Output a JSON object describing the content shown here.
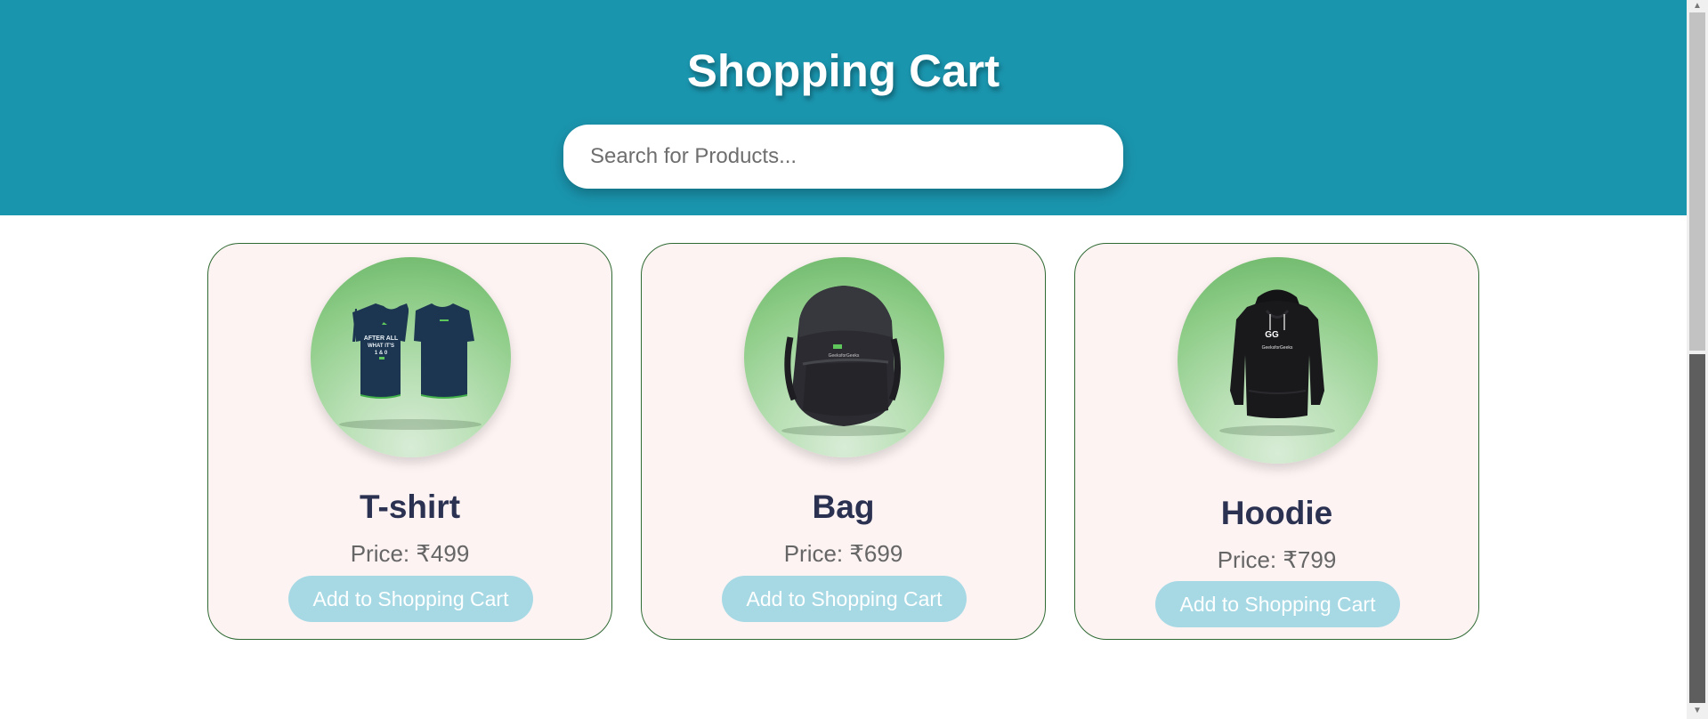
{
  "header": {
    "title": "Shopping Cart",
    "background_color": "#1a95ae"
  },
  "search": {
    "placeholder": "Search for Products...",
    "value": ""
  },
  "products": [
    {
      "name": "T-shirt",
      "price": "Price: ₹499",
      "button_label": "Add to Shopping Cart",
      "icon": "tshirt-icon"
    },
    {
      "name": "Bag",
      "price": "Price: ₹699",
      "button_label": "Add to Shopping Cart",
      "icon": "backpack-icon"
    },
    {
      "name": "Hoodie",
      "price": "Price: ₹799",
      "button_label": "Add to Shopping Cart",
      "icon": "hoodie-icon"
    }
  ],
  "colors": {
    "card_background": "#fdf3f3",
    "card_border": "#2f6a33",
    "button_background": "#a7d9e5",
    "title_text": "#2b3151"
  }
}
